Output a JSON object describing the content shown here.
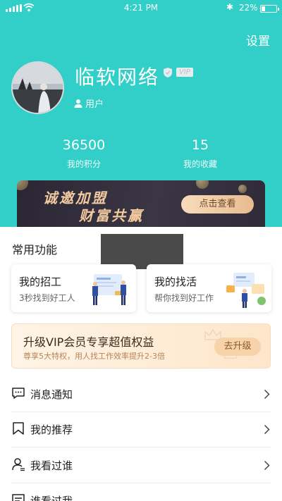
{
  "status_bar": {
    "time": "4:21 PM",
    "battery": "22%"
  },
  "header": {
    "settings_label": "设置"
  },
  "profile": {
    "name": "临软网络",
    "vip_badge": "VIP",
    "role": "用户"
  },
  "stats": [
    {
      "value": "36500",
      "label": "我的积分"
    },
    {
      "value": "15",
      "label": "我的收藏"
    }
  ],
  "banner": {
    "line1": "诚邀加盟",
    "line2": "财富共赢",
    "button": "点击查看"
  },
  "common": {
    "title": "常用功能"
  },
  "cards": [
    {
      "title": "我的招工",
      "subtitle": "3秒找到好工人"
    },
    {
      "title": "我的找活",
      "subtitle": "帮你找到好工作"
    }
  ],
  "vip_promo": {
    "title": "升级VIP会员专享超值权益",
    "subtitle": "尊享5大特权，用人找工作效率提升2-3倍",
    "button": "去升级"
  },
  "menu": [
    {
      "label": "消息通知",
      "icon": "message-icon"
    },
    {
      "label": "我的推荐",
      "icon": "bookmark-icon"
    },
    {
      "label": "我看过谁",
      "icon": "person-icon"
    },
    {
      "label": "谁看过我",
      "icon": "document-icon"
    }
  ],
  "colors": {
    "primary": "#31cfc7",
    "banner_gold": "#f3c99f",
    "vip_bg": "#fde6ca"
  }
}
